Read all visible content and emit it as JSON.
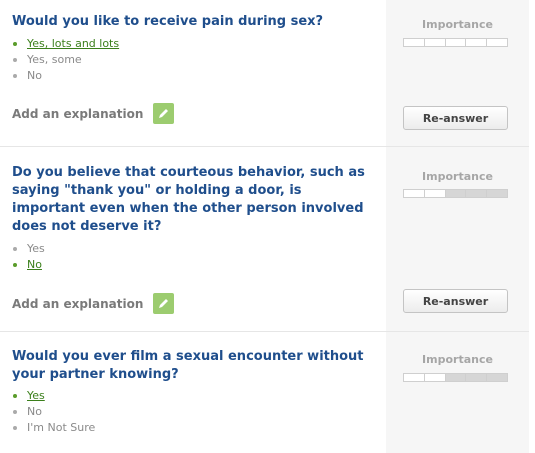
{
  "questions": [
    {
      "title": "Would you like to receive pain during sex?",
      "answers": [
        {
          "label": "Yes, lots and lots",
          "selected": true
        },
        {
          "label": "Yes, some",
          "selected": false
        },
        {
          "label": "No",
          "selected": false
        }
      ],
      "add_explanation": "Add an explanation",
      "importance_label": "Importance",
      "importance_filled_segments": 0,
      "importance_total_segments": 5,
      "reanswer_label": "Re-answer"
    },
    {
      "title": "Do you believe that courteous behavior, such as saying \"thank you\" or holding a door, is important even when the other person involved does not deserve it?",
      "answers": [
        {
          "label": "Yes",
          "selected": false
        },
        {
          "label": "No",
          "selected": true
        }
      ],
      "add_explanation": "Add an explanation",
      "importance_label": "Importance",
      "importance_filled_segments": 3,
      "importance_total_segments": 5,
      "reanswer_label": "Re-answer"
    },
    {
      "title": "Would you ever film a sexual encounter without your partner knowing?",
      "answers": [
        {
          "label": "Yes",
          "selected": true
        },
        {
          "label": "No",
          "selected": false
        },
        {
          "label": "I'm Not Sure",
          "selected": false
        }
      ],
      "importance_label": "Importance",
      "importance_filled_segments": 3,
      "importance_total_segments": 5
    }
  ]
}
